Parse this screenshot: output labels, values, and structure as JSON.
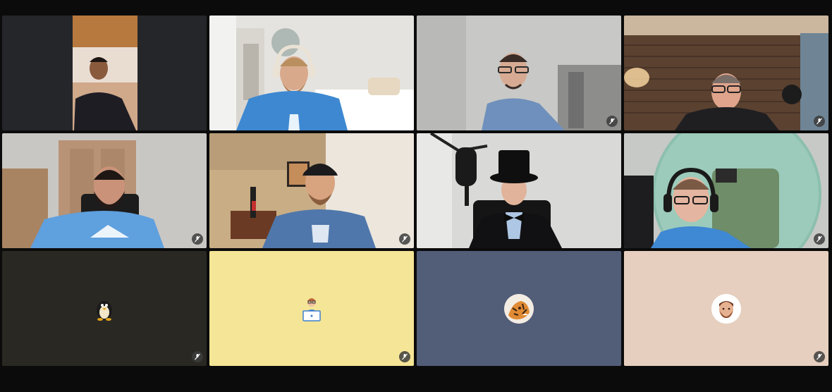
{
  "meeting": {
    "participants": [
      {
        "kind": "video",
        "scene": "warm-room-man-dark-shirt",
        "muted": false
      },
      {
        "kind": "video",
        "scene": "bedroom-man-headphones-blue-shirt",
        "muted": false
      },
      {
        "kind": "video",
        "scene": "blurred-bg-man-glasses-blue-shirt",
        "muted": true
      },
      {
        "kind": "video",
        "scene": "wood-cabin-man-glasses-hoodie",
        "muted": true
      },
      {
        "kind": "video",
        "scene": "doorway-man-beard-blue-shirt",
        "muted": true
      },
      {
        "kind": "video",
        "scene": "wood-room-man-cap-blue-shirt",
        "muted": true
      },
      {
        "kind": "video",
        "scene": "mic-man-top-hat-bowtie",
        "muted": false
      },
      {
        "kind": "video",
        "scene": "gaming-chair-man-headphones-glasses",
        "muted": true
      },
      {
        "kind": "avatar",
        "tile_color": "#2a2822",
        "avatar_icon": "penguin-icon",
        "muted": true
      },
      {
        "kind": "avatar",
        "tile_color": "#f5e596",
        "avatar_icon": "laptop-person-icon",
        "muted": true
      },
      {
        "kind": "avatar",
        "tile_color": "#525d78",
        "avatar_icon": "tiger-icon",
        "muted": false
      },
      {
        "kind": "avatar",
        "tile_color": "#e6cfbe",
        "avatar_icon": "memoji-man-icon",
        "muted": true
      }
    ]
  }
}
